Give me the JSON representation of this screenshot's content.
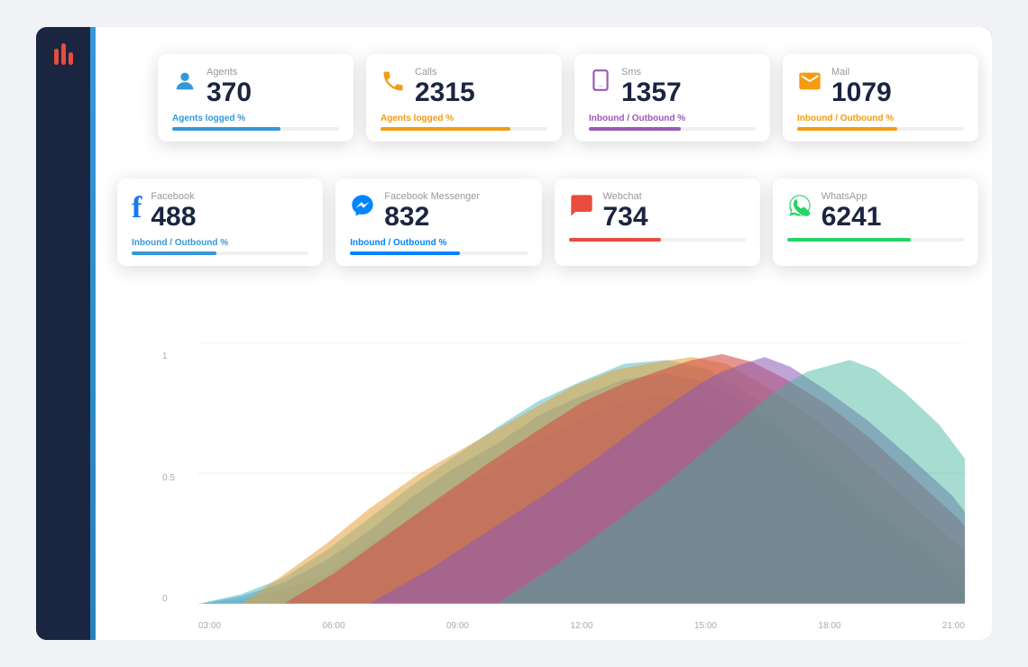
{
  "sidebar": {
    "logo": "|||"
  },
  "cards": {
    "row1": [
      {
        "id": "agents",
        "label": "Agents",
        "value": "370",
        "footer_label": "Agents logged %",
        "footer_color": "label-blue",
        "bar_color": "bar-blue",
        "bar_width": "65%",
        "icon": "👤",
        "icon_class": "icon-agents"
      },
      {
        "id": "calls",
        "label": "Calls",
        "value": "2315",
        "footer_label": "Agents logged %",
        "footer_color": "label-orange",
        "bar_color": "bar-orange",
        "bar_width": "78%",
        "icon": "📞",
        "icon_class": "icon-calls"
      },
      {
        "id": "sms",
        "label": "Sms",
        "value": "1357",
        "footer_label": "Inbound / Outbound %",
        "footer_color": "label-purple",
        "bar_color": "bar-purple",
        "bar_width": "55%",
        "icon": "📱",
        "icon_class": "icon-sms"
      },
      {
        "id": "mail",
        "label": "Mail",
        "value": "1079",
        "footer_label": "Inbound / Outbound %",
        "footer_color": "label-orange",
        "bar_color": "bar-orange",
        "bar_width": "60%",
        "icon": "✉️",
        "icon_class": "icon-mail"
      }
    ],
    "row2": [
      {
        "id": "facebook",
        "label": "Facebook",
        "value": "488",
        "footer_label": "Inbound / Outbound %",
        "footer_color": "label-blue",
        "bar_color": "bar-blue",
        "bar_width": "48%",
        "icon": "f",
        "icon_class": "icon-facebook"
      },
      {
        "id": "messenger",
        "label": "Facebook Messenger",
        "value": "832",
        "footer_label": "Inbound / Outbound %",
        "footer_color": "label-messenger",
        "bar_color": "bar-messenger",
        "bar_width": "62%",
        "icon": "💬",
        "icon_class": "icon-messenger"
      },
      {
        "id": "webchat",
        "label": "Webchat",
        "value": "734",
        "footer_label": "",
        "footer_color": "label-red",
        "bar_color": "bar-red",
        "bar_width": "52%",
        "icon": "💬",
        "icon_class": "icon-webchat"
      },
      {
        "id": "whatsapp",
        "label": "WhatsApp",
        "value": "6241",
        "footer_label": "",
        "footer_color": "label-green",
        "bar_color": "bar-green",
        "bar_width": "70%",
        "icon": "✆",
        "icon_class": "icon-whatsapp"
      }
    ]
  },
  "chart": {
    "y_labels": [
      "1",
      "0.5",
      "0"
    ],
    "x_labels": [
      "03:00",
      "06:00",
      "09:00",
      "12:00",
      "15:00",
      "18:00",
      "21:00"
    ]
  }
}
